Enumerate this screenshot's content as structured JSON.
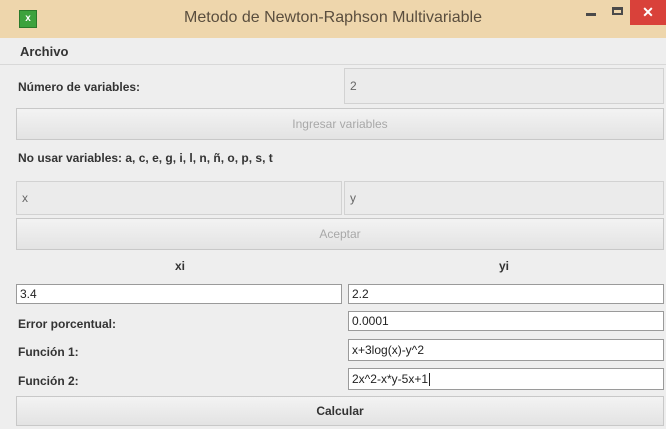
{
  "window": {
    "title": "Metodo de Newton-Raphson Multivariable",
    "icon": "java-app-icon",
    "close_glyph": "✕"
  },
  "menu": {
    "items": [
      "Archivo"
    ]
  },
  "form": {
    "num_vars_label": "Número de variables:",
    "num_vars_value": "2",
    "ingresar_button": "Ingresar variables",
    "no_usar_label": "No usar variables: a, c, e, g, i, l, n, ñ, o, p, s, t",
    "var_names": [
      "x",
      "y"
    ],
    "aceptar_button": "Aceptar",
    "headers": [
      "xi",
      "yi"
    ],
    "initial_values": [
      "3.4",
      "2.2"
    ],
    "error_label": "Error porcentual:",
    "error_value": "0.0001",
    "f1_label": "Función 1:",
    "f1_value": "x+3log(x)-y^2",
    "f2_label": "Función 2:",
    "f2_value": "2x^2-x*y-5x+1",
    "calcular_button": "Calcular"
  }
}
